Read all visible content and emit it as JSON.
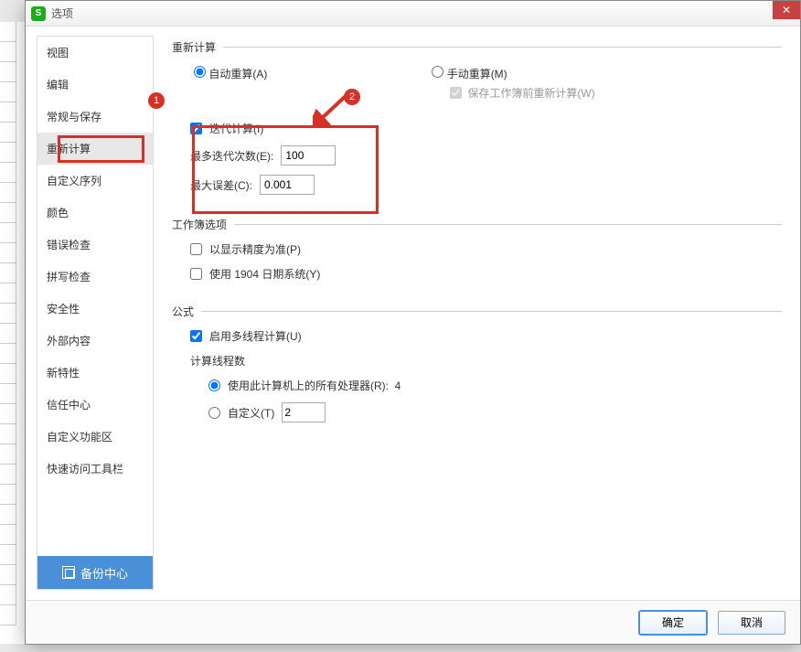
{
  "dialog": {
    "title": "选项"
  },
  "sidebar": {
    "items": [
      {
        "label": "视图"
      },
      {
        "label": "编辑"
      },
      {
        "label": "常规与保存"
      },
      {
        "label": "重新计算"
      },
      {
        "label": "自定义序列"
      },
      {
        "label": "颜色"
      },
      {
        "label": "错误检查"
      },
      {
        "label": "拼写检查"
      },
      {
        "label": "安全性"
      },
      {
        "label": "外部内容"
      },
      {
        "label": "新特性"
      },
      {
        "label": "信任中心"
      },
      {
        "label": "自定义功能区"
      },
      {
        "label": "快速访问工具栏"
      }
    ],
    "backup_label": "备份中心"
  },
  "sections": {
    "recalc": {
      "legend": "重新计算",
      "auto": "自动重算(A)",
      "manual": "手动重算(M)",
      "save_before": "保存工作簿前重新计算(W)"
    },
    "iter": {
      "enable": "迭代计算(I)",
      "max_iter_label": "最多迭代次数(E):",
      "max_iter_value": "100",
      "max_change_label": "最大误差(C):",
      "max_change_value": "0.001"
    },
    "workbook": {
      "legend": "工作簿选项",
      "precision": "以显示精度为准(P)",
      "date1904": "使用 1904 日期系统(Y)"
    },
    "formula": {
      "legend": "公式",
      "multithread": "启用多线程计算(U)",
      "threads_label": "计算线程数",
      "use_all": "使用此计算机上的所有处理器(R):",
      "cpu_count": "4",
      "custom": "自定义(T)",
      "custom_value": "2"
    }
  },
  "footer": {
    "ok": "确定",
    "cancel": "取消"
  },
  "annotations": {
    "badge1": "1",
    "badge2": "2"
  }
}
